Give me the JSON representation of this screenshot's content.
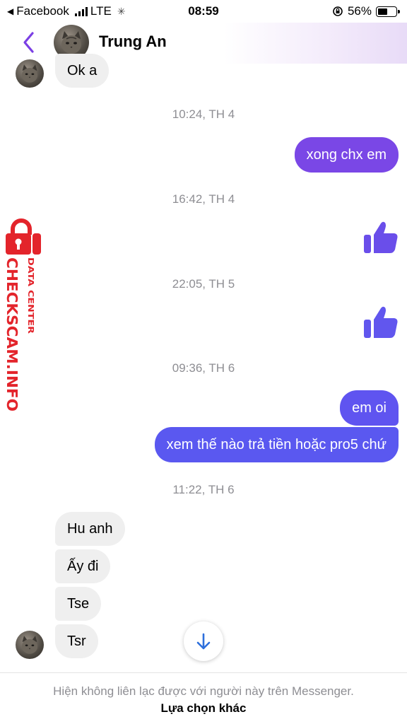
{
  "status_bar": {
    "back_app": "Facebook",
    "network": "LTE",
    "time": "08:59",
    "battery_percent": "56%",
    "battery_level": 0.56
  },
  "header": {
    "contact_name": "Trung An"
  },
  "messages": {
    "m1": "Ok a",
    "t1": "10:24, TH 4",
    "m2": "xong chx em",
    "t2": "16:42, TH 4",
    "t3": "22:05, TH 5",
    "t4": "09:36, TH 6",
    "m3": "em oi",
    "m4": "xem thế nào trả tiền hoặc pro5 chứ",
    "t5": "11:22, TH 6",
    "m5": "Hu anh",
    "m6": "Ấy đi",
    "m7": "Tse",
    "m8": "Tsr"
  },
  "watermark": {
    "brand": "CHECKSCAM.INFO",
    "tagline": "DATA CENTER"
  },
  "footer": {
    "notice": "Hiện không liên lạc được với người này trên Messenger.",
    "link": "Lựa chọn khác"
  },
  "colors": {
    "accent": "#7b3fe4",
    "outgoing_top": "#7a46e6",
    "outgoing_bottom": "#5a58f0",
    "incoming": "#efefef",
    "watermark": "#e3242b"
  }
}
